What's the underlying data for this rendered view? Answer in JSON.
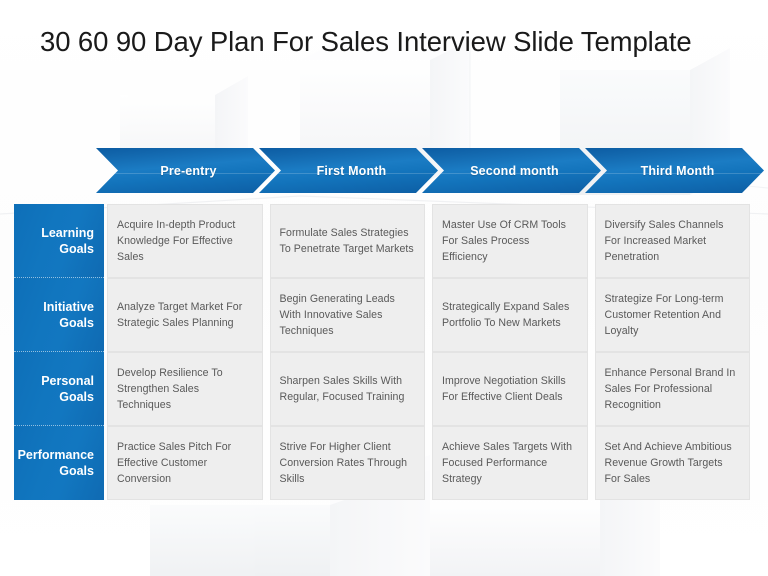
{
  "slide": {
    "title": "30 60 90 Day Plan For Sales Interview Slide Template",
    "accent_blue": "#1277c0",
    "accent_blue_dark": "#0c5ca3",
    "cell_background": "#eeeeee",
    "cell_text_color": "#595959",
    "background": "#ffffff"
  },
  "columns": [
    {
      "label": "Pre-entry"
    },
    {
      "label": "First Month"
    },
    {
      "label": "Second month"
    },
    {
      "label": "Third Month"
    }
  ],
  "rows": [
    {
      "label": "Learning Goals",
      "label_line1": "Learning",
      "label_line2": "Goals",
      "cells": [
        "Acquire In-depth Product Knowledge For Effective Sales",
        "Formulate Sales Strategies To Penetrate Target Markets",
        "Master Use Of CRM Tools For Sales Process Efficiency",
        "Diversify Sales Channels For Increased Market Penetration"
      ]
    },
    {
      "label": "Initiative Goals",
      "label_line1": "Initiative",
      "label_line2": "Goals",
      "cells": [
        "Analyze Target Market For Strategic Sales Planning",
        "Begin Generating Leads With Innovative Sales Techniques",
        "Strategically Expand Sales Portfolio To New Markets",
        "Strategize For Long-term Customer Retention And Loyalty"
      ]
    },
    {
      "label": "Personal Goals",
      "label_line1": "Personal",
      "label_line2": "Goals",
      "cells": [
        "Develop Resilience To Strengthen Sales Techniques",
        "Sharpen Sales Skills With Regular, Focused Training",
        "Improve Negotiation Skills For Effective Client Deals",
        "Enhance Personal Brand In Sales For Professional Recognition"
      ]
    },
    {
      "label": "Performance Goals",
      "label_line1": "Performance",
      "label_line2": "Goals",
      "cells": [
        "Practice Sales Pitch For Effective Customer Conversion",
        "Strive For Higher Client Conversion Rates Through Skills",
        "Achieve Sales Targets With Focused Performance Strategy",
        "Set And Achieve Ambitious Revenue Growth Targets For Sales"
      ]
    }
  ]
}
